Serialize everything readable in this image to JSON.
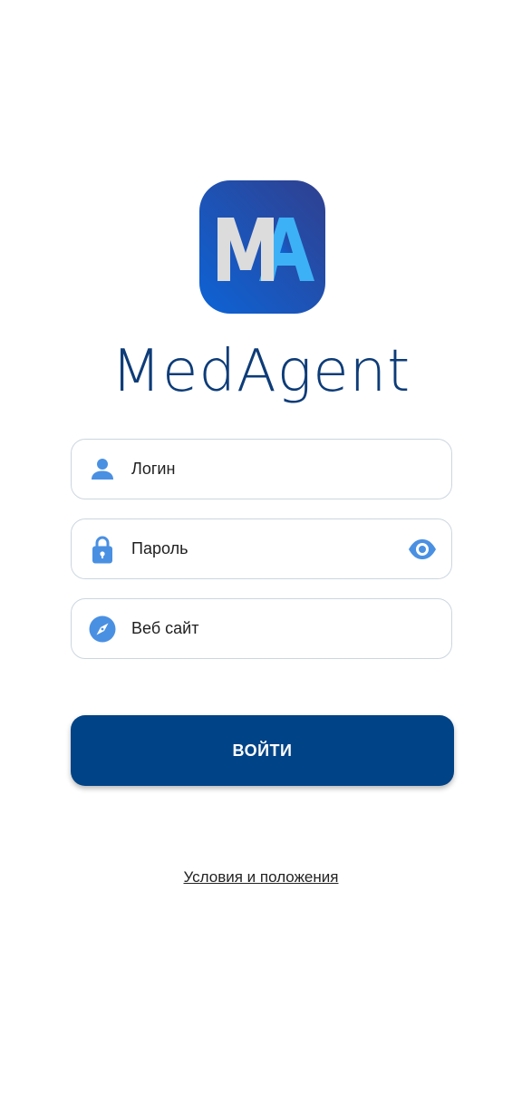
{
  "branding": {
    "logo_letters": "MA",
    "app_name": "MedAgent"
  },
  "form": {
    "login_placeholder": "Логин",
    "login_icon": "user-icon",
    "password_placeholder": "Пароль",
    "password_icon": "lock-icon",
    "password_toggle_icon": "eye-icon",
    "website_placeholder": "Веб сайт",
    "website_icon": "compass-icon"
  },
  "actions": {
    "login_label": "ВОЙТИ"
  },
  "footer": {
    "terms_link": "Условия и положения"
  },
  "colors": {
    "primary": "#004386",
    "title": "#0d3c78",
    "icon": "#4a90e2",
    "field_border": "#ccd6e0"
  }
}
